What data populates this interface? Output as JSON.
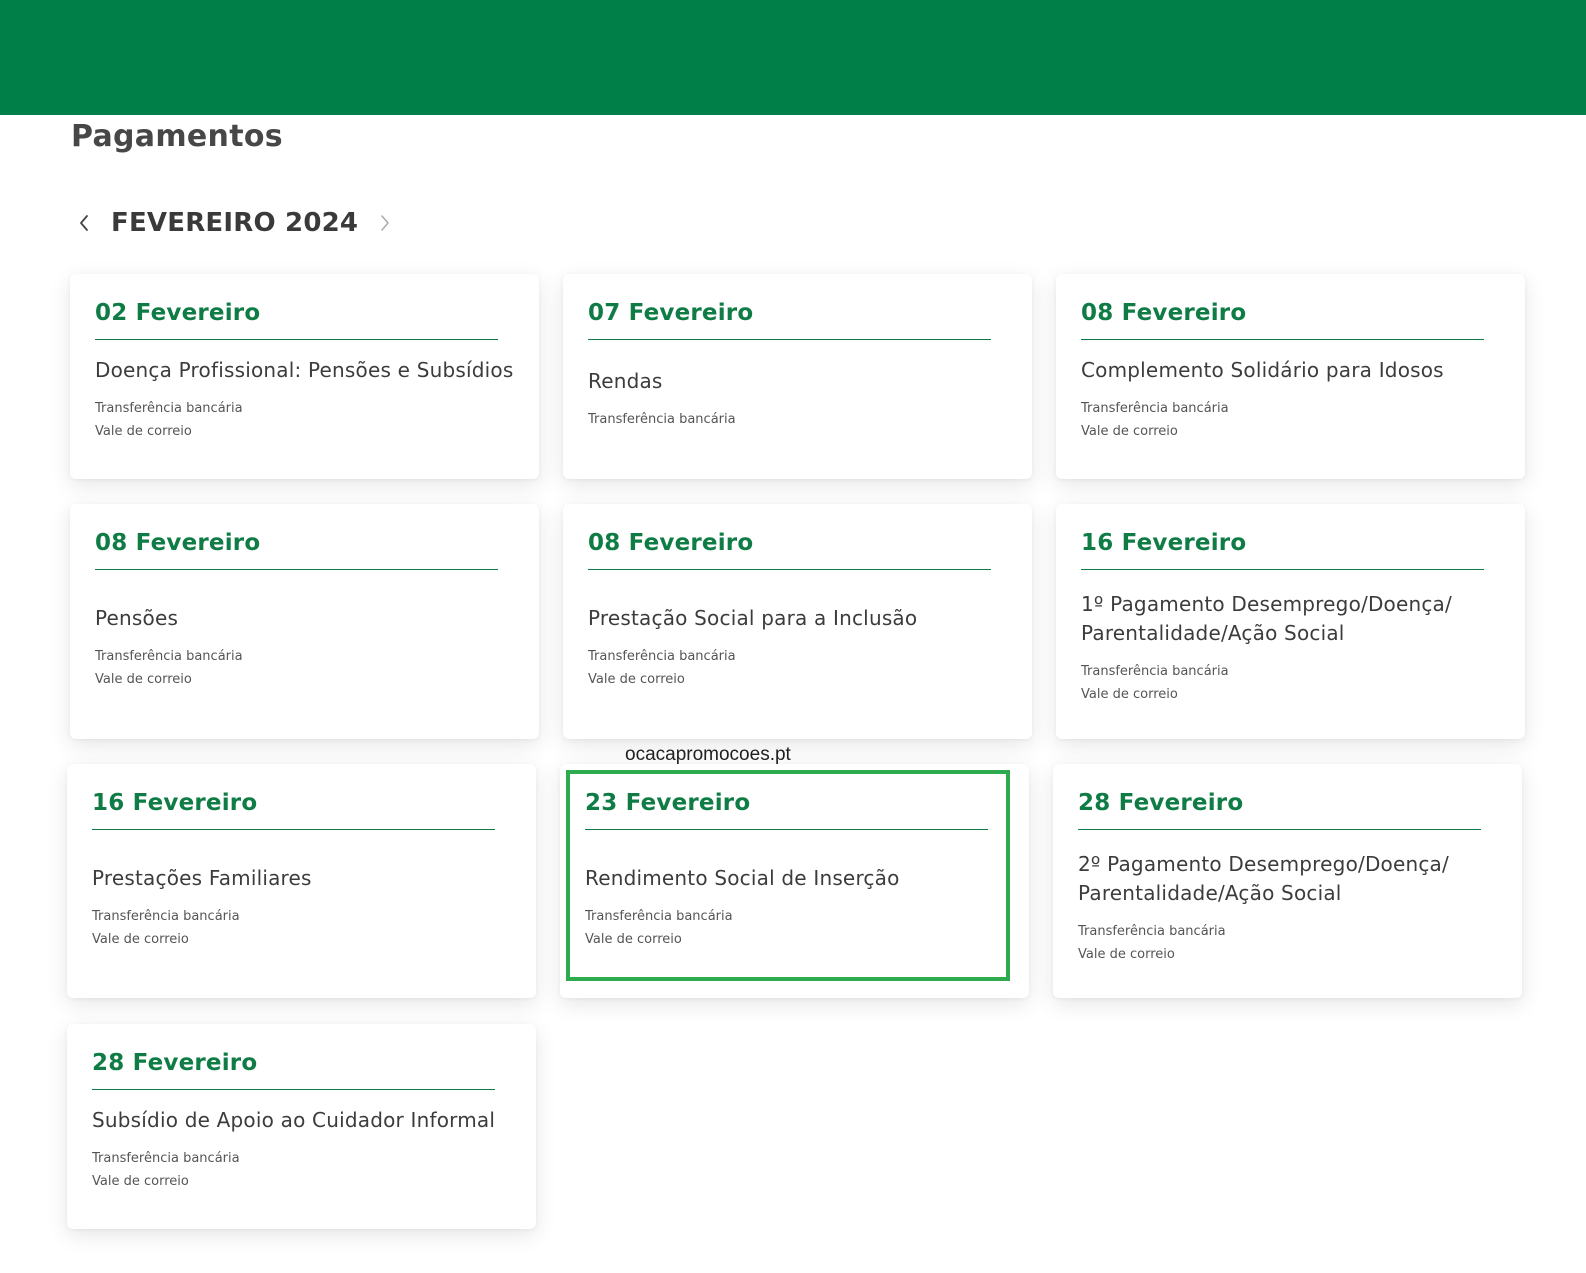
{
  "page": {
    "title": "Pagamentos",
    "month_label": "FEVEREIRO 2024",
    "prev_icon": "chevron-left-icon",
    "next_icon": "chevron-right-icon"
  },
  "colors": {
    "header_green": "#008048",
    "accent_green": "#0f7c46",
    "highlight_green": "#2eab4f"
  },
  "watermark": "ocacapromocoes.pt",
  "cards": [
    {
      "date": "02 Fevereiro",
      "benefit": "Doença Profissional: Pensões e Subsídios",
      "methods": [
        "Transferência bancária",
        "Vale de correio"
      ]
    },
    {
      "date": "07 Fevereiro",
      "benefit": "Rendas",
      "methods": [
        "Transferência bancária"
      ]
    },
    {
      "date": "08 Fevereiro",
      "benefit": "Complemento Solidário para Idosos",
      "methods": [
        "Transferência bancária",
        "Vale de correio"
      ]
    },
    {
      "date": "08 Fevereiro",
      "benefit": "Pensões",
      "methods": [
        "Transferência bancária",
        "Vale de correio"
      ]
    },
    {
      "date": "08 Fevereiro",
      "benefit": "Prestação Social para a Inclusão",
      "methods": [
        "Transferência bancária",
        "Vale de correio"
      ]
    },
    {
      "date": "16 Fevereiro",
      "benefit": "1º Pagamento Desemprego/Doença/ Parentalidade/Ação Social",
      "methods": [
        "Transferência bancária",
        "Vale de correio"
      ]
    },
    {
      "date": "16 Fevereiro",
      "benefit": "Prestações Familiares",
      "methods": [
        "Transferência bancária",
        "Vale de correio"
      ]
    },
    {
      "date": "23 Fevereiro",
      "benefit": "Rendimento Social de Inserção",
      "methods": [
        "Transferência bancária",
        "Vale de correio"
      ]
    },
    {
      "date": "28 Fevereiro",
      "benefit": "2º Pagamento Desemprego/Doença/ Parentalidade/Ação Social",
      "methods": [
        "Transferência bancária",
        "Vale de correio"
      ]
    },
    {
      "date": "28 Fevereiro",
      "benefit": "Subsídio de Apoio ao Cuidador Informal",
      "methods": [
        "Transferência bancária",
        "Vale de correio"
      ]
    }
  ]
}
